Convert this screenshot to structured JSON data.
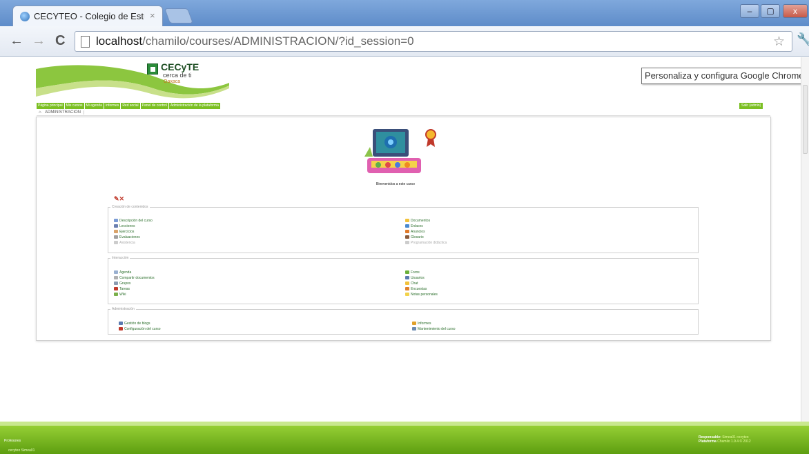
{
  "browser": {
    "tab_title": "CECYTEO - Colegio de Estu",
    "tab_close": "×",
    "url_host": "localhost",
    "url_path": "/chamilo/courses/ADMINISTRACION/?id_session=0",
    "back": "←",
    "forward": "→",
    "reload": "C",
    "star": "☆",
    "wrench": "🔧",
    "min": "–",
    "max": "▢",
    "close": "x",
    "tooltip": "Personaliza y configura Google Chrome"
  },
  "logo": {
    "title": "CECyTE",
    "subtitle": "cerca de ti",
    "region": "Oaxaca"
  },
  "nav": {
    "items": [
      "Página principal",
      "Mis cursos",
      "Mi agenda",
      "Informes",
      "Red social",
      "Panel de control",
      "Administración de la plataforma"
    ],
    "logout": "Salir (admin)"
  },
  "breadcrumb": {
    "course": "ADMINISTRACION"
  },
  "welcome": "Bienvenidos a este curso",
  "sections": {
    "content": {
      "legend": "Creación de contenidos",
      "left": [
        "Descripción del curso",
        "Lecciones",
        "Ejercicios",
        "Evaluaciones",
        "Asistencia"
      ],
      "right": [
        "Documentos",
        "Enlaces",
        "Anuncios",
        "Glosario",
        "Programación didáctica"
      ]
    },
    "interaction": {
      "legend": "Interacción",
      "left": [
        "Agenda",
        "Compartir documentos",
        "Grupos",
        "Tareas",
        "Wiki"
      ],
      "right": [
        "Foros",
        "Usuarios",
        "Chat",
        "Encuestas",
        "Notas personales"
      ]
    },
    "admin": {
      "legend": "Administración",
      "left": [
        "Gestión de blogs",
        "Configuración del curso"
      ],
      "right": [
        "Informes",
        "Mantenimiento del curso"
      ]
    }
  },
  "footer": {
    "left": "Profesores",
    "left2": "cecyteo Simea01",
    "right1_label": "Responsable:",
    "right1_value": "Simea01 cecyteo",
    "right2_label": "Plataforma",
    "right2_value": "Chamilo 1.9.4 © 2012"
  },
  "colors": {
    "accent_green": "#7bbf22",
    "link_green": "#2a6e2a"
  }
}
